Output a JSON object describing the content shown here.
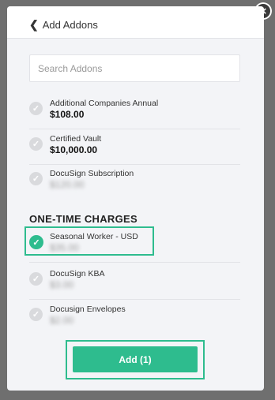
{
  "header": {
    "back_label": "Add Addons"
  },
  "search": {
    "placeholder": "Search Addons"
  },
  "recurring_items": [
    {
      "name": "Additional Companies Annual",
      "price": "$108.00",
      "checked": false
    },
    {
      "name": "Certified Vault",
      "price": "$10,000.00",
      "checked": false
    },
    {
      "name": "DocuSign Subscription",
      "price": "$120.00",
      "checked": false
    }
  ],
  "one_time": {
    "title": "ONE-TIME CHARGES",
    "items": [
      {
        "name": "Seasonal Worker - USD",
        "price": "$35.00",
        "checked": true
      },
      {
        "name": "DocuSign KBA",
        "price": "$3.00",
        "checked": false
      },
      {
        "name": "Docusign Envelopes",
        "price": "$2.00",
        "checked": false
      }
    ]
  },
  "footer": {
    "add_label": "Add (1)"
  },
  "colors": {
    "accent": "#2ebc8e",
    "unchecked": "#d9dadd"
  }
}
